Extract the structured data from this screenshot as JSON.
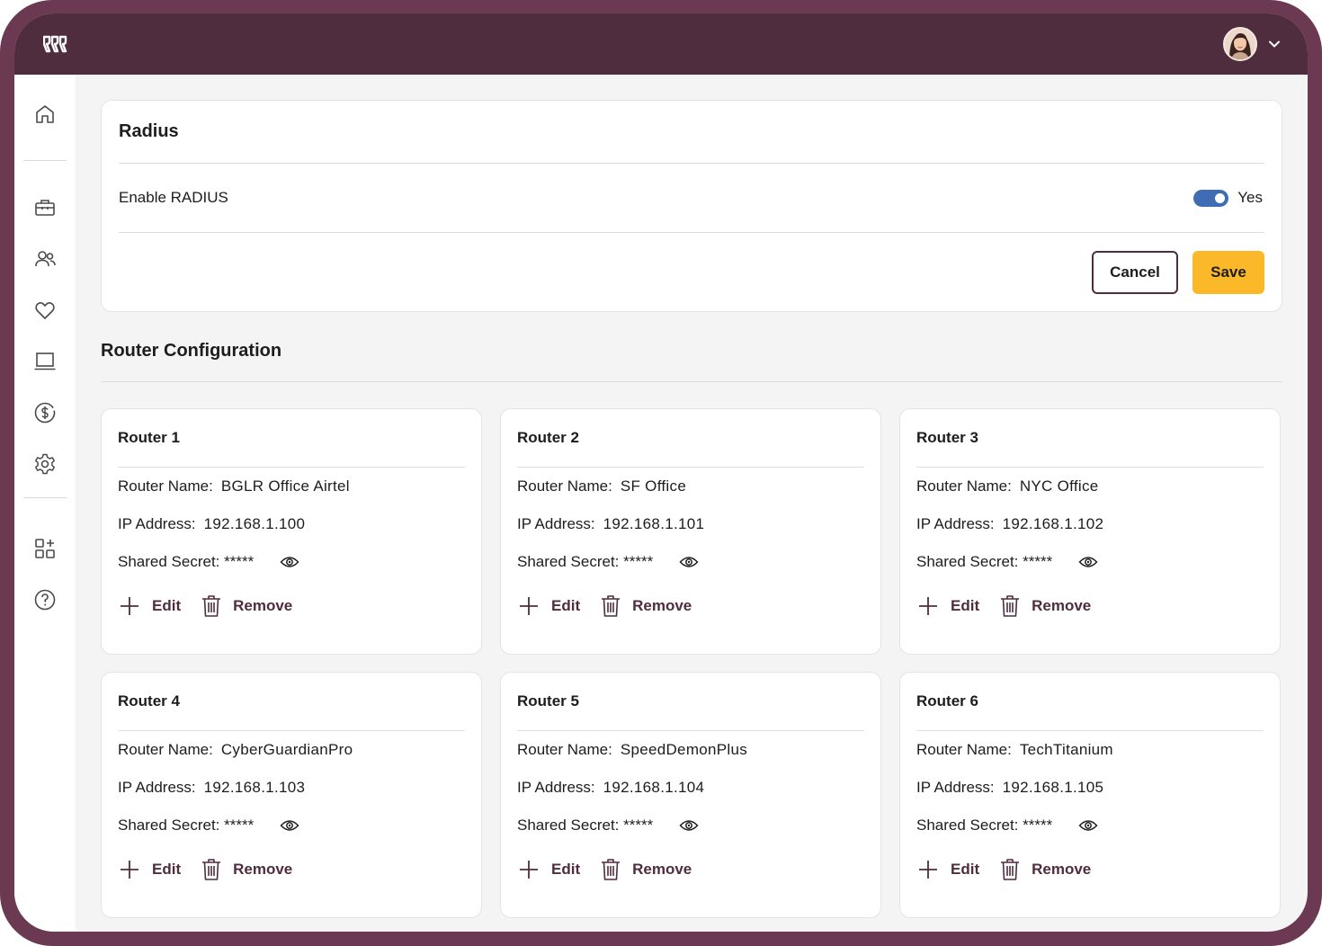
{
  "header": {
    "avatar_alt": "User avatar"
  },
  "sidebar": {
    "items": [
      {
        "name": "home"
      },
      {
        "name": "toolbox"
      },
      {
        "name": "users"
      },
      {
        "name": "heart"
      },
      {
        "name": "laptop"
      },
      {
        "name": "dollar"
      },
      {
        "name": "settings"
      },
      {
        "name": "apps-add"
      },
      {
        "name": "help"
      }
    ]
  },
  "radius": {
    "title": "Radius",
    "enable_label": "Enable RADIUS",
    "toggle_state": "Yes",
    "enabled": true,
    "cancel_label": "Cancel",
    "save_label": "Save"
  },
  "router_section": {
    "title": "Router Configuration",
    "field_labels": {
      "name": "Router Name:",
      "ip": "IP Address:",
      "secret": "Shared Secret: *****"
    },
    "edit_label": "Edit",
    "remove_label": "Remove",
    "routers": [
      {
        "title": "Router 1",
        "name": "BGLR Office Airtel",
        "ip": "192.168.1.100"
      },
      {
        "title": "Router 2",
        "name": "SF Office",
        "ip": "192.168.1.101"
      },
      {
        "title": "Router 3",
        "name": "NYC Office",
        "ip": "192.168.1.102"
      },
      {
        "title": "Router 4",
        "name": "CyberGuardianPro",
        "ip": "192.168.1.103"
      },
      {
        "title": "Router 5",
        "name": "SpeedDemonPlus",
        "ip": "192.168.1.104"
      },
      {
        "title": "Router 6",
        "name": "TechTitanium",
        "ip": "192.168.1.105"
      }
    ]
  },
  "colors": {
    "frame": "#6b3a52",
    "topbar": "#4f2c3e",
    "accent_button": "#fbb829",
    "toggle": "#3f6db4",
    "action_text": "#4f2c3e"
  }
}
